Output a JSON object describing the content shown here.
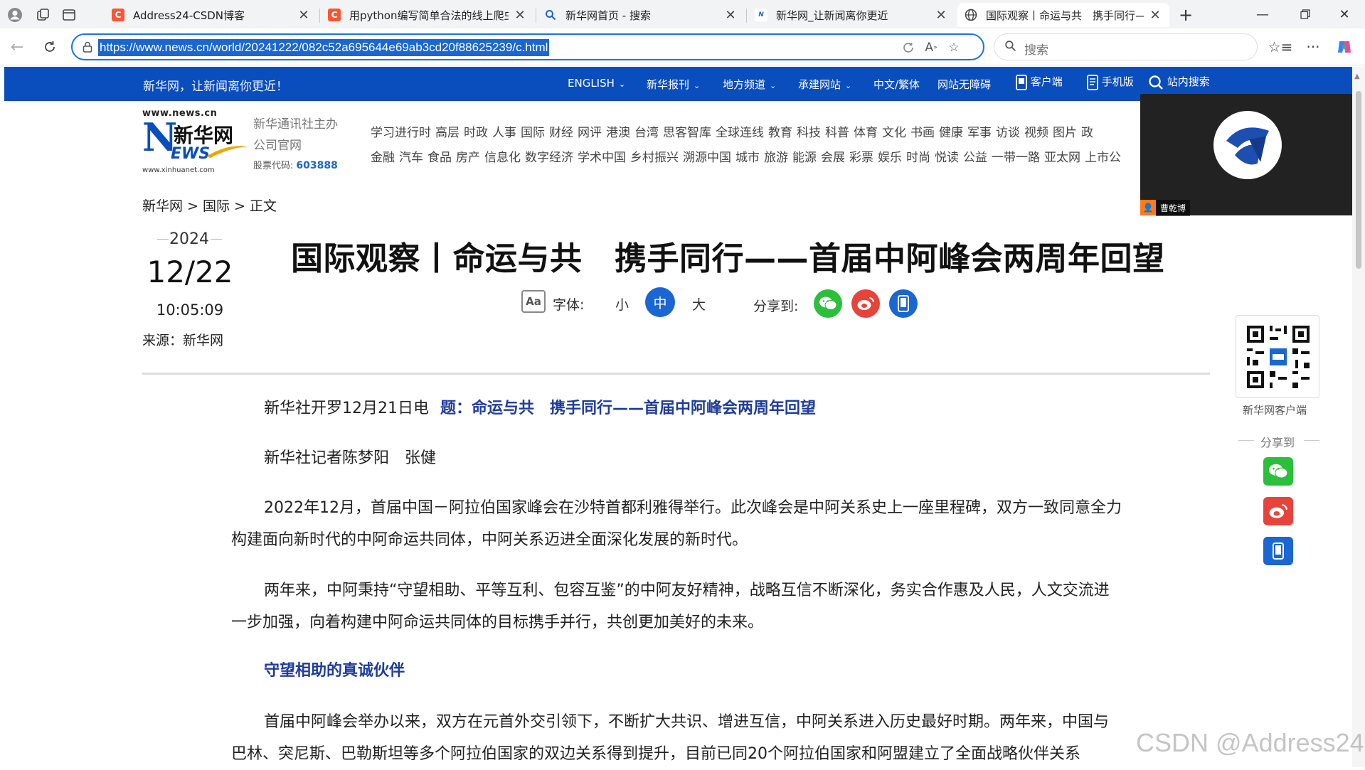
{
  "browser": {
    "tabs": [
      {
        "title": "Address24-CSDN博客",
        "favicon": "csdn-icon",
        "color": "#fc5531"
      },
      {
        "title": "用python编写简单合法的线上爬虫",
        "favicon": "csdn-icon",
        "color": "#fc5531"
      },
      {
        "title": "新华网首页 - 搜索",
        "favicon": "search-icon",
        "color": "#1a66d2"
      },
      {
        "title": "新华网_让新闻离你更近",
        "favicon": "news-icon",
        "color": "#1a66d2"
      },
      {
        "title": "国际观察丨命运与共　携手同行——首届中阿峰会两周年回望",
        "favicon": "globe-icon",
        "color": "#444444"
      }
    ],
    "active_tab": 4,
    "url": "https://www.news.cn/world/20241222/082c52a695644e69ab3cd20f88625239/c.html",
    "search_placeholder": "搜索"
  },
  "site": {
    "slogan": "新华网，让新闻离你更近！",
    "top_nav": [
      {
        "label": "ENGLISH",
        "dropdown": true
      },
      {
        "label": "新华报刊",
        "dropdown": true
      },
      {
        "label": "地方频道",
        "dropdown": true
      },
      {
        "label": "承建网站",
        "dropdown": true
      },
      {
        "label": "中文/繁体",
        "dropdown": false
      },
      {
        "label": "网站无障碍",
        "dropdown": false
      },
      {
        "label": "客户端",
        "icon": "phone-app-icon"
      },
      {
        "label": "手机版",
        "icon": "mobile-icon"
      },
      {
        "label": "站内搜索",
        "icon": "search-icon"
      }
    ],
    "logo": {
      "url_top": "www.news.cn",
      "letter": "N",
      "ews": "EWS",
      "cn_name": "新华网",
      "url_bottom": "www.xinhuanet.com"
    },
    "sponsor_line1": "新华通讯社主办",
    "sponsor_line2": "公司官网",
    "stock_label": "股票代码:",
    "stock_code": "603888",
    "channels_row1": [
      "学习进行时",
      "高层",
      "时政",
      "人事",
      "国际",
      "财经",
      "网评",
      "港澳",
      "台湾",
      "思客智库",
      "全球连线",
      "教育",
      "科技",
      "科普",
      "体育",
      "文化",
      "书画",
      "健康",
      "军事",
      "访谈",
      "视频",
      "图片",
      "政"
    ],
    "channels_row2": [
      "金融",
      "汽车",
      "食品",
      "房产",
      "信息化",
      "数字经济",
      "学术中国",
      "乡村振兴",
      "溯源中国",
      "城市",
      "旅游",
      "能源",
      "会展",
      "彩票",
      "娱乐",
      "时尚",
      "悦读",
      "公益",
      "一带一路",
      "亚太网",
      "上市公"
    ]
  },
  "video_overlay": {
    "user_name": "曹乾博"
  },
  "article": {
    "breadcrumb": "新华网 > 国际 > 正文",
    "year": "2024",
    "month_day": "12/22",
    "time": "10:05:09",
    "source": "来源：新华网",
    "headline": "国际观察丨命运与共　携手同行——首届中阿峰会两周年回望",
    "font_label": "字体:",
    "font_sizes": {
      "small": "小",
      "medium": "中",
      "large": "大"
    },
    "share_label": "分享到:",
    "dateline": "新华社开罗12月21日电",
    "dateline_title": "题：命运与共　携手同行——首届中阿峰会两周年回望",
    "reporters": "新华社记者陈梦阳　张健",
    "paragraphs": [
      "2022年12月，首届中国－阿拉伯国家峰会在沙特首都利雅得举行。此次峰会是中阿关系史上一座里程碑，双方一致同意全力构建面向新时代的中阿命运共同体，中阿关系迈进全面深化发展的新时代。",
      "两年来，中阿秉持“守望相助、平等互利、包容互鉴”的中阿友好精神，战略互信不断深化，务实合作惠及人民，人文交流进一步加强，向着构建中阿命运共同体的目标携手并行，共创更加美好的未来。"
    ],
    "subhead": "守望相助的真诚伙伴",
    "paragraph_last": "首届中阿峰会举办以来，双方在元首外交引领下，不断扩大共识、增进互信，中阿关系进入历史最好时期。两年来，中国与巴林、突尼斯、巴勒斯坦等多个阿拉伯国家的双边关系得到提升，目前已同20个阿拉伯国家和阿盟建立了全面战略伙伴关系"
  },
  "sidebar": {
    "qr_label": "新华网客户端",
    "share_label": "分享到"
  },
  "watermark": "CSDN @Address24",
  "colors": {
    "site_blue": "#0a4dbc",
    "accent_blue": "#1a66d2",
    "headline_blue": "#1f3c9c",
    "wechat": "#2bbf3a",
    "weibo": "#e8433b"
  }
}
